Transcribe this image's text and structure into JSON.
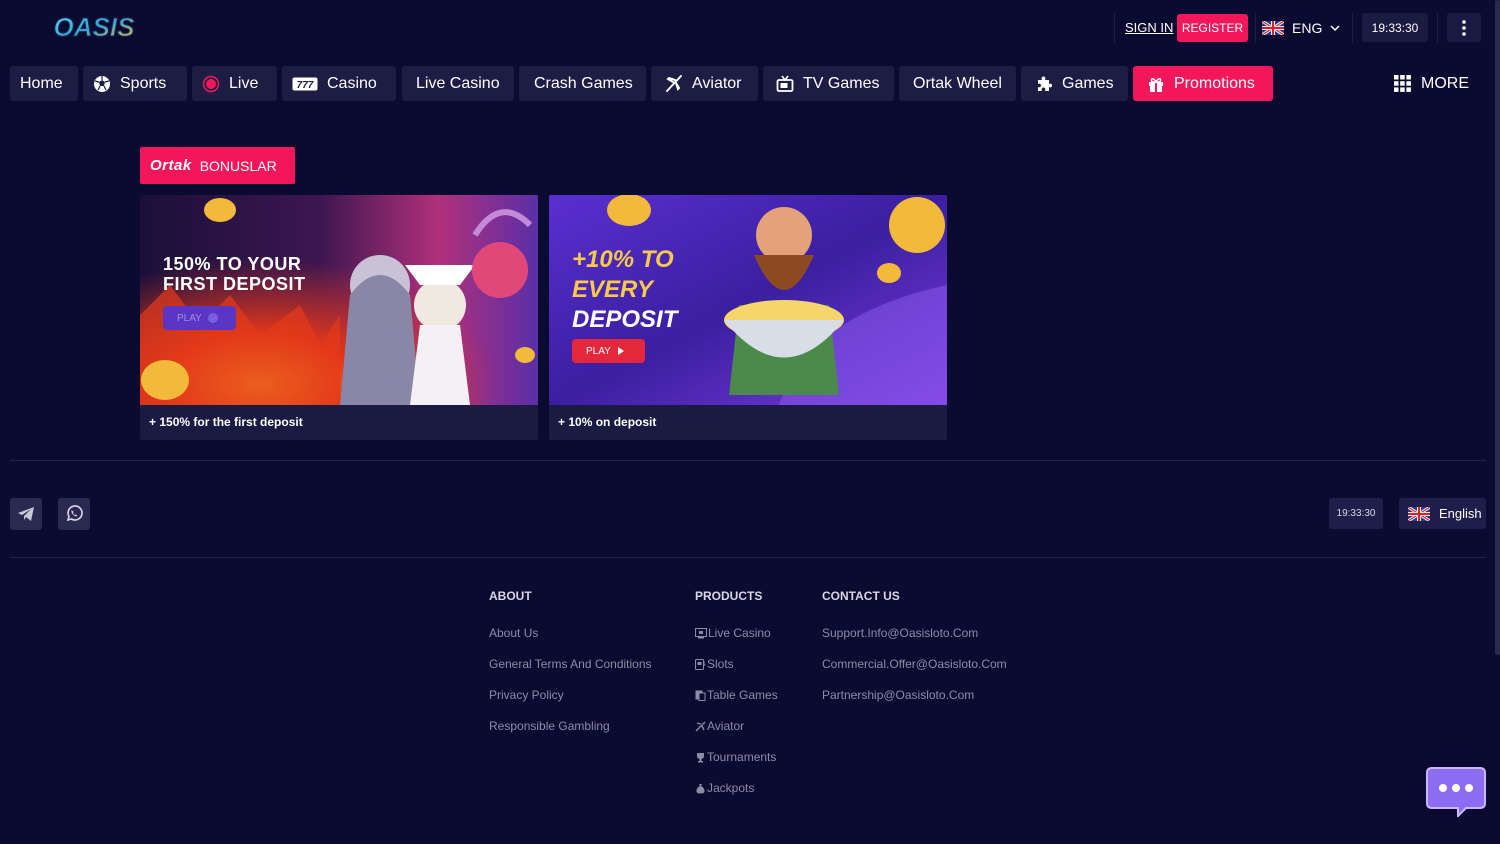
{
  "brand": {
    "logo_text": "OASIS"
  },
  "header": {
    "sign_in": "SIGN IN",
    "register": "REGISTER",
    "language": "ENG",
    "time": "19:33:30"
  },
  "nav": [
    {
      "label": "Home",
      "icon": "none"
    },
    {
      "label": "Sports",
      "icon": "soccer-ball-icon"
    },
    {
      "label": "Live",
      "icon": "live-dot-icon"
    },
    {
      "label": "Casino",
      "icon": "slot-777-icon"
    },
    {
      "label": "Live Casino",
      "icon": "none"
    },
    {
      "label": "Crash Games",
      "icon": "none"
    },
    {
      "label": "Aviator",
      "icon": "plane-icon"
    },
    {
      "label": "TV Games",
      "icon": "tv-icon"
    },
    {
      "label": "Ortak Wheel",
      "icon": "none"
    },
    {
      "label": "Games",
      "icon": "puzzle-icon"
    },
    {
      "label": "Promotions",
      "icon": "gift-icon",
      "active": true
    }
  ],
  "more_label": "MORE",
  "promotions": {
    "tab_brand": "Ortak",
    "tab_label": "BONUSLAR",
    "cards": [
      {
        "banner_line1": "150% TO YOUR",
        "banner_line2": "FIRST DEPOSIT",
        "play": "PLAY",
        "caption": "+ 150% for the first deposit"
      },
      {
        "banner_line1": "+10% TO",
        "banner_line2": "EVERY",
        "banner_line3": "DEPOSIT",
        "play": "PLAY",
        "caption": "+ 10% on deposit"
      }
    ]
  },
  "footer": {
    "time": "19:33:30",
    "language": "English",
    "about": {
      "heading": "ABOUT",
      "links": [
        "About Us",
        "General Terms And Conditions",
        "Privacy Policy",
        "Responsible Gambling"
      ]
    },
    "products": {
      "heading": "PRODUCTS",
      "links": [
        "Live Casino",
        "Slots",
        "Table Games",
        "Aviator",
        "Tournaments",
        "Jackpots"
      ]
    },
    "contact": {
      "heading": "CONTACT US",
      "links": [
        "Support.Info@Oasisloto.Com",
        "Commercial.Offer@Oasisloto.Com",
        "Partnership@Oasisloto.Com"
      ]
    }
  },
  "colors": {
    "background": "#0b0a30",
    "accent": "#f2175a",
    "nav_bg": "#1d1c44"
  }
}
